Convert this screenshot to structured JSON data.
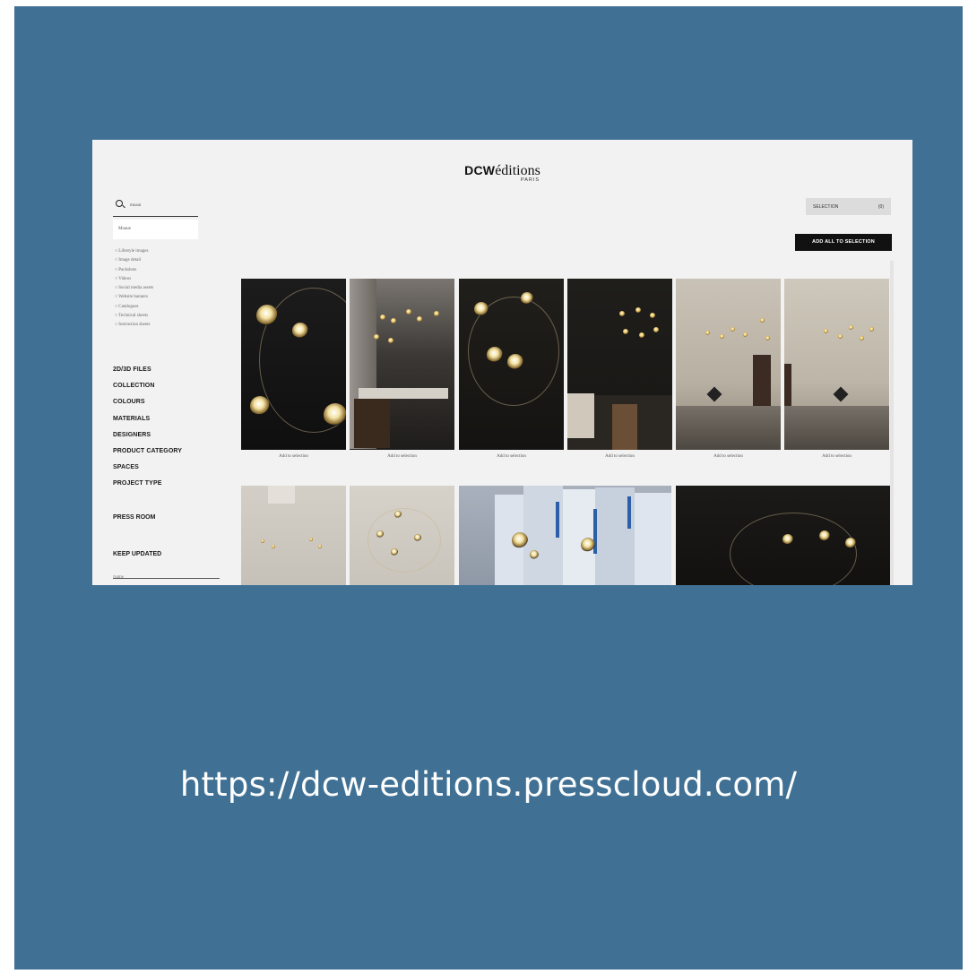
{
  "brand": {
    "name_bold": "DCW",
    "name_light": "éditions",
    "city": "PARIS"
  },
  "search": {
    "value": "moaul"
  },
  "suggestion": {
    "label": "Moaue"
  },
  "filters": [
    "Lifestyle images",
    "Image detail",
    "Packshots",
    "Videos",
    "Social media assets",
    "Website banners",
    "Catalogues",
    "Technical sheets",
    "Instruction sheets"
  ],
  "nav": [
    "2D/3D FILES",
    "COLLECTION",
    "COLOURS",
    "MATERIALS",
    "DESIGNERS",
    "PRODUCT CATEGORY",
    "SPACES",
    "PROJECT TYPE"
  ],
  "press_room": "PRESS ROOM",
  "newsletter": {
    "title": "KEEP UPDATED",
    "name_placeholder": "Name"
  },
  "selection": {
    "label": "SELECTION",
    "count": "(0)"
  },
  "add_all_label": "ADD ALL TO SELECTION",
  "captions": [
    "Add to selection",
    "Add to selection",
    "Add to selection",
    "Add to selection",
    "Add to selection",
    "Add to selection"
  ],
  "footer_url": "https://dcw-editions.presscloud.com/"
}
